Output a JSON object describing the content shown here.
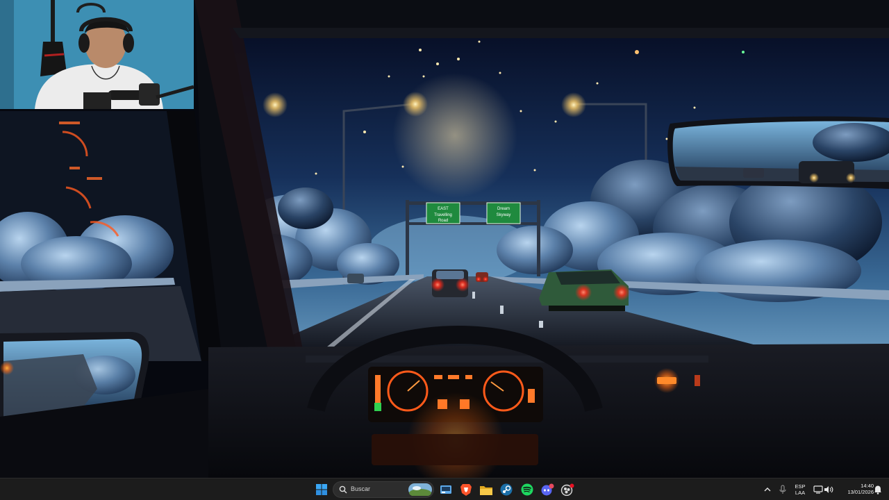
{
  "wallpaper": {
    "title": "Lofi night drive wallpaper",
    "sign_left": {
      "line1": "EAST",
      "line2": "Travelling",
      "line3": "Road"
    },
    "sign_right": {
      "line1": "Dream",
      "line2": "Skyway",
      "line3": ""
    }
  },
  "webcam": {
    "description": "Streamer webcam overlay"
  },
  "taskbar": {
    "search": {
      "label": "Buscar"
    },
    "apps": [
      {
        "name": "start-icon"
      },
      {
        "name": "task-view-icon"
      },
      {
        "name": "brave-browser-icon"
      },
      {
        "name": "file-explorer-icon"
      },
      {
        "name": "steam-icon"
      },
      {
        "name": "spotify-icon"
      },
      {
        "name": "discord-icon"
      },
      {
        "name": "obs-icon"
      }
    ],
    "tray": {
      "language_top": "ESP",
      "language_bottom": "LAA",
      "time": "14:40",
      "date": "13/01/2026"
    },
    "colors": {
      "start": "#2f9cf2",
      "brave": "#fb542b",
      "explorer": "#f3c338",
      "steam": "#1b6fa8",
      "spotify": "#1ed760",
      "discord": "#5865f2",
      "obs": "#2a2a2a"
    }
  }
}
